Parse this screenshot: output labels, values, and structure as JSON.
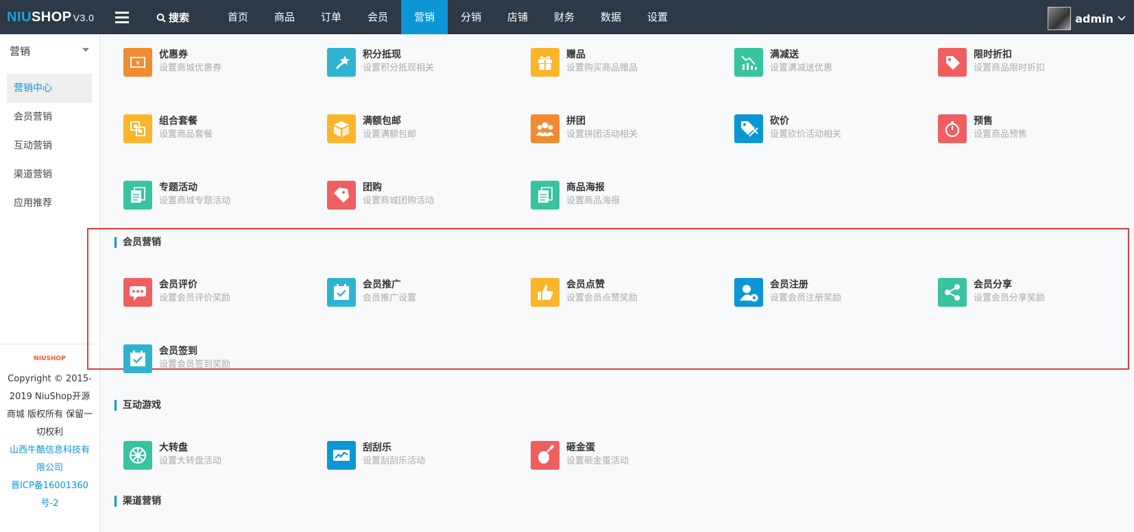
{
  "logo": {
    "part1": "NIU",
    "part2": "SHOP",
    "version": "V3.0"
  },
  "header": {
    "search_label": "搜索",
    "nav": [
      "首页",
      "商品",
      "订单",
      "会员",
      "营销",
      "分销",
      "店铺",
      "财务",
      "数据",
      "设置"
    ],
    "active_nav": "营销",
    "user": "admin"
  },
  "sidebar": {
    "title": "营销",
    "items": [
      "营销中心",
      "会员营销",
      "互动营销",
      "渠道营销",
      "应用推荐"
    ],
    "mini_logo": "NIUSHOP",
    "copyright": "Copyright © 2015-2019 NiuShop开源商城 版权所有 保留一切权利",
    "company_line1": "山西牛酷信息科技有限公司",
    "company_line2": "晋ICP备16001360号-2"
  },
  "colors": {
    "accent": "#0c96d6",
    "orange": "#f28b30",
    "cyan": "#2fb4d0",
    "yellow": "#fbb529",
    "teal": "#38c4a0",
    "red": "#f05f60",
    "blue": "#0c96d6",
    "highlight": "#e23a3a"
  },
  "row1": [
    {
      "name": "优惠券",
      "desc": "设置商城优惠券",
      "icon": "coupon-icon",
      "color": "#f28b30"
    },
    {
      "name": "积分抵现",
      "desc": "设置积分抵现相关",
      "icon": "magic-wand-icon",
      "color": "#2fb4d0"
    },
    {
      "name": "赠品",
      "desc": "设置购买商品赠品",
      "icon": "gift-icon",
      "color": "#fbb529"
    },
    {
      "name": "满减送",
      "desc": "设置满减送优惠",
      "icon": "chart-down-icon",
      "color": "#38c4a0"
    },
    {
      "name": "限时折扣",
      "desc": "设置商品限时折扣",
      "icon": "tag-icon",
      "color": "#f05f60"
    }
  ],
  "row2": [
    {
      "name": "组合套餐",
      "desc": "设置商品套餐",
      "icon": "combo-icon",
      "color": "#fbb529"
    },
    {
      "name": "满额包邮",
      "desc": "设置满额包邮",
      "icon": "box-icon",
      "color": "#fbb529"
    },
    {
      "name": "拼团",
      "desc": "设置拼团活动相关",
      "icon": "group-icon",
      "color": "#f28b30"
    },
    {
      "name": "砍价",
      "desc": "设置砍价活动相关",
      "icon": "price-cut-icon",
      "color": "#0c96d6"
    },
    {
      "name": "预售",
      "desc": "设置商品预售",
      "icon": "timer-icon",
      "color": "#f05f60"
    }
  ],
  "row3": [
    {
      "name": "专题活动",
      "desc": "设置商城专题活动",
      "icon": "documents-icon",
      "color": "#38c4a0"
    },
    {
      "name": "团购",
      "desc": "设置商城团购活动",
      "icon": "tags-icon",
      "color": "#f05f60"
    },
    {
      "name": "商品海报",
      "desc": "设置商品海报",
      "icon": "documents-icon",
      "color": "#38c4a0"
    }
  ],
  "sections": {
    "member": "会员营销",
    "games": "互动游戏",
    "channel": "渠道营销"
  },
  "member": [
    {
      "name": "会员评价",
      "desc": "设置会员评价奖励",
      "icon": "comment-icon",
      "color": "#f05f60"
    },
    {
      "name": "会员推广",
      "desc": "会员推广设置",
      "icon": "calendar-check-icon",
      "color": "#2fb4d0"
    },
    {
      "name": "会员点赞",
      "desc": "设置会员点赞奖励",
      "icon": "thumbs-up-icon",
      "color": "#fbb529"
    },
    {
      "name": "会员注册",
      "desc": "设置会员注册奖励",
      "icon": "user-add-icon",
      "color": "#0c96d6"
    },
    {
      "name": "会员分享",
      "desc": "设置会员分享奖励",
      "icon": "share-icon",
      "color": "#38c4a0"
    }
  ],
  "member2": [
    {
      "name": "会员签到",
      "desc": "设置会员签到奖励",
      "icon": "calendar-check-icon",
      "color": "#2fb4d0"
    }
  ],
  "games": [
    {
      "name": "大转盘",
      "desc": "设置大转盘活动",
      "icon": "wheel-icon",
      "color": "#38c4a0"
    },
    {
      "name": "刮刮乐",
      "desc": "设置刮刮乐活动",
      "icon": "scratch-card-icon",
      "color": "#0c96d6"
    },
    {
      "name": "砸金蛋",
      "desc": "设置砸金蛋活动",
      "icon": "egg-icon",
      "color": "#f05f60"
    }
  ]
}
